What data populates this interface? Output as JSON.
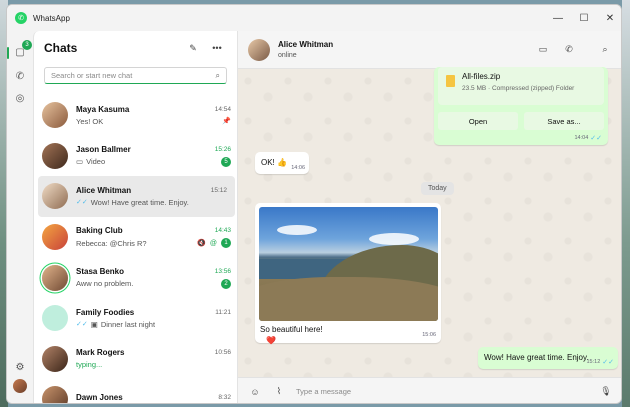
{
  "app": {
    "title": "WhatsApp"
  },
  "window_controls": {
    "minimize": "—",
    "maximize": "☐",
    "close": "✕"
  },
  "rail": {
    "chats_badge": "3"
  },
  "chats": {
    "title": "Chats",
    "search_placeholder": "Search or start new chat",
    "items": [
      {
        "name": "Maya Kasuma",
        "time": "14:54",
        "preview": "Yes! OK",
        "avatar": "#c58f62"
      },
      {
        "name": "Jason Ballmer",
        "time": "15:26",
        "preview": "Video",
        "unread": "5",
        "avatar": "#6b4a35"
      },
      {
        "name": "Alice Whitman",
        "time": "15:12",
        "preview": "Wow! Have great time. Enjoy.",
        "avatar": "#d8b99a"
      },
      {
        "name": "Baking Club",
        "time": "14:43",
        "preview": "Rebecca: @Chris R?",
        "unread": "1",
        "avatar": "#e07b3c"
      },
      {
        "name": "Stasa Benko",
        "time": "13:56",
        "preview": "Aww no problem.",
        "unread": "2",
        "avatar": "#b57e5a"
      },
      {
        "name": "Family Foodies",
        "time": "11:21",
        "preview": "Dinner last night",
        "avatar": "#b7e8d2"
      },
      {
        "name": "Mark Rogers",
        "time": "10:56",
        "preview": "typing...",
        "avatar": "#7b5540"
      },
      {
        "name": "Dawn Jones",
        "time": "8:32",
        "preview": "",
        "avatar": "#9b6a4c"
      }
    ]
  },
  "conversation": {
    "name": "Alice Whitman",
    "status": "online",
    "file": {
      "name": "All-files.zip",
      "meta": "23.5 MB · Compressed (zipped) Folder",
      "open_label": "Open",
      "save_label": "Save as...",
      "time": "14:04"
    },
    "msg_ok": {
      "text": "OK! 👍",
      "time": "14:06"
    },
    "date_separator": "Today",
    "photo_msg": {
      "caption": "So beautiful here!",
      "time": "15:06",
      "reaction": "❤️"
    },
    "out_msg": {
      "text": "Wow! Have great time. Enjoy.",
      "time": "15:12"
    },
    "composer_placeholder": "Type a message"
  }
}
